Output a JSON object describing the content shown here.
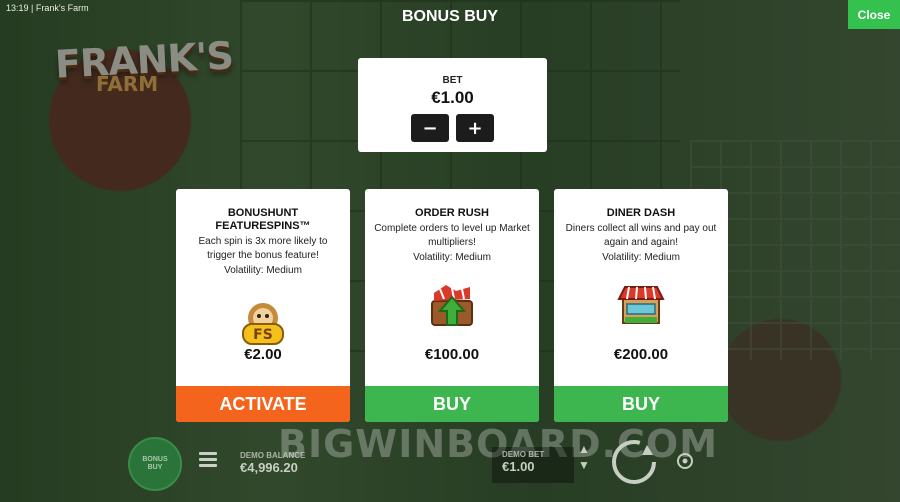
{
  "status_bar": {
    "time": "13:19",
    "app_name": "Frank's Farm"
  },
  "logo": {
    "line1": "FRANK'S",
    "line2": "FARM"
  },
  "title": "BONUS BUY",
  "close_label": "Close",
  "bet": {
    "label": "BET",
    "value": "€1.00",
    "minus": "−",
    "plus": "+"
  },
  "cards": [
    {
      "name": "BONUSHUNT FEATURESPINS™",
      "description": "Each spin is 3x more likely to trigger the bonus feature!",
      "volatility": "Volatility: Medium",
      "icon_label": "FS",
      "price": "€2.00",
      "action": "ACTIVATE"
    },
    {
      "name": "ORDER RUSH",
      "description": "Complete orders to level up Market multipliers!",
      "volatility": "Volatility: Medium",
      "price": "€100.00",
      "action": "BUY"
    },
    {
      "name": "DINER DASH",
      "description": "Diners collect all wins and pay out again and again!",
      "volatility": "Volatility: Medium",
      "price": "€200.00",
      "action": "BUY"
    }
  ],
  "colors": {
    "activate": "#f4641d",
    "buy": "#3db650",
    "close": "#35c14e"
  },
  "bottom": {
    "bonus_buy_line1": "BONUS",
    "bonus_buy_line2": "BUY",
    "balance_label": "DEMO BALANCE",
    "balance_value": "€4,996.20",
    "bet_label": "DEMO BET",
    "bet_value": "€1.00"
  },
  "watermark": "BIGWINBOARD.COM"
}
